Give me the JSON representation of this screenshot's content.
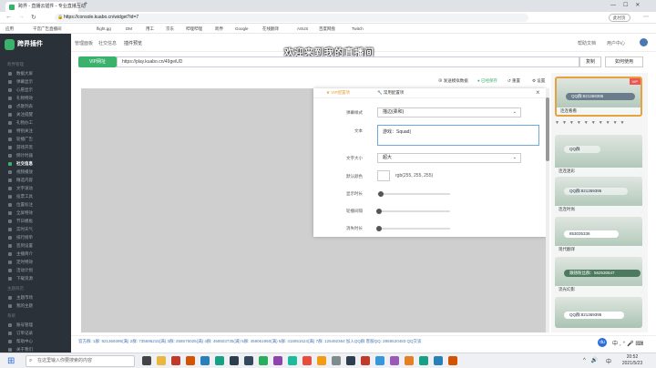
{
  "browser": {
    "tab_title": "跨界 - 直播云插件 - 专业直播互动",
    "new_tab": "+",
    "url": "https://console.kuabo.cn/widget?id=7",
    "profile_label": "此付页"
  },
  "bookmarks": [
    "应用",
    "千宫广告直播间",
    "flight.gg",
    "DM",
    "用工",
    "京东",
    "哔哩哔哩",
    "跨界",
    "Google",
    "在线翻译",
    "ASUS",
    "百度网盘",
    "Twitch"
  ],
  "sidebar": {
    "logo": "跨界插件",
    "section1": "跨界管理",
    "items": [
      "数据大屏",
      "弹幕显示",
      "心愿显示",
      "礼物特效",
      "点歌列表",
      "关注提醒",
      "礼物办工",
      "特别关注",
      "轮播广告",
      "游戏开黑",
      "倒计时器",
      "社交信息",
      "视频播放",
      "精选内容",
      "文字滚动",
      "投票工具",
      "位置标注",
      "全屏特效",
      "节日模板",
      "实时天气",
      "排行榜单",
      "签到设置",
      "主播简介",
      "定时特效",
      "活动计划",
      "下载资源"
    ],
    "active_index": 11,
    "section2": "主题商店",
    "items2": [
      "主题市场",
      "我的主题"
    ],
    "section3": "系统",
    "items3": [
      "账号管理",
      "订单记录",
      "帮助中心",
      "关于我们"
    ]
  },
  "header": {
    "breadcrumbs": [
      "管理面板",
      "社交信息",
      "插件预览"
    ],
    "help": "帮助文档",
    "user": "用户中心"
  },
  "overlay_text": "欢迎来到我的直播间",
  "url_row": {
    "vip_label": "VIP网址",
    "url_value": "https://play.kuabo.cn/49geiUD",
    "copy_label": "复制",
    "how_label": "如何使用"
  },
  "toolbar": {
    "send": "发送模拟数据",
    "saved": "已经保存",
    "reset": "重置",
    "settings": "设置"
  },
  "panel": {
    "tab_vip": "VIP配置项",
    "tab_common": "常用配置项",
    "close": "×",
    "fields": {
      "style_label": "弹幕样式",
      "style_value": "描边(柔和)",
      "text_label": "文本",
      "text_value": "游戏：Squad",
      "size_label": "文字大小",
      "size_value": "超大",
      "color_label": "默认颜色",
      "color_value": "rgb(255, 255, 255)",
      "show_label": "显示时长",
      "interval_label": "轮播间隔",
      "fade_label": "消失时长"
    },
    "sliders": {
      "show": 0.05,
      "interval": 0.03,
      "fade": 0.03
    }
  },
  "right_cards": [
    {
      "pill": "QQ群:821369395",
      "caption": "连连看看",
      "badge": "VIP"
    },
    {
      "pill": "QQ群",
      "caption": "连连迷彩"
    },
    {
      "pill": "QQ群:821369395",
      "caption": "连连时尚"
    },
    {
      "pill": "853035336",
      "caption": "现代翻译"
    },
    {
      "pill": "跟随粉丝群：562530647",
      "caption": "流光幻影"
    },
    {
      "pill": "QQ群:821369395",
      "caption": ""
    }
  ],
  "bottom_info": "官方群: 1群: 821369395(满)  2群: 735696215(满)  3群: 258675025(满)  4群: 459503735(满)  5群: 459061950(满)  6群: 418051524(满)  7群: 125492364  加入QQ群  客服QQ: 2859520483  QQ交谈",
  "taskbar": {
    "search_placeholder": "在这里输入你要搜索的内容",
    "time": "20:52",
    "date": "2021/5/23",
    "lang": "中"
  },
  "colors": {
    "accent": "#3ab26b",
    "sidebar": "#2b3138"
  }
}
